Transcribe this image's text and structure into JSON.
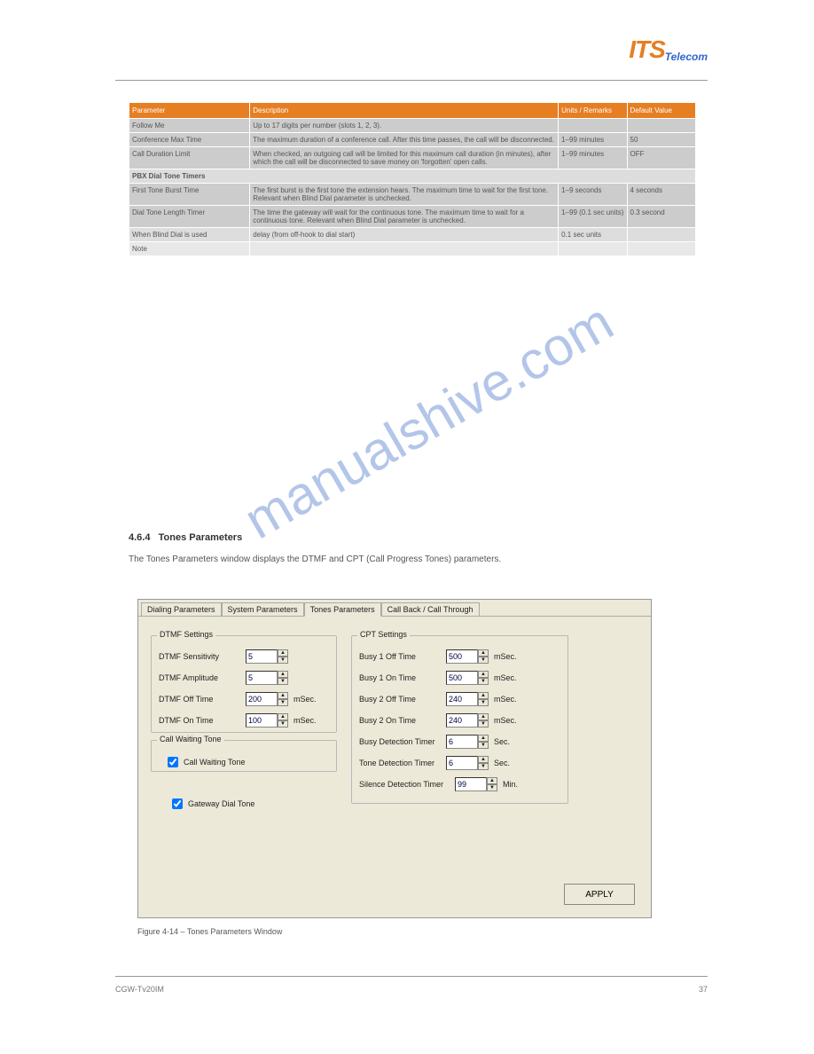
{
  "logo": {
    "its": "ITS",
    "telecom": "Telecom"
  },
  "table": {
    "headers": [
      "Parameter",
      "Description",
      "Units / Remarks",
      "Default Value"
    ],
    "rows": [
      {
        "c1": "Follow Me",
        "c2": "Up to 17 digits per number (slots 1, 2, 3).",
        "c3": "",
        "c4": ""
      },
      {
        "c1": "Conference Max Time",
        "c2": "The maximum duration of a conference call. After this time passes, the call will be disconnected.",
        "c3": "1–99 minutes",
        "c4": "50"
      },
      {
        "c1": "Call Duration Limit",
        "c2": "When checked, an outgoing call will be limited for this maximum call duration (in minutes), after which the call will be disconnected to save money on 'forgotten' open calls.",
        "c3": "1–99 minutes",
        "c4": "OFF"
      }
    ],
    "section": "PBX Dial Tone Timers",
    "rows2": [
      {
        "c1": "First Tone Burst Time",
        "c2": "The first burst is the first tone the extension hears. The maximum time to wait for the first tone. Relevant when Blind Dial parameter is unchecked.",
        "c3": "1–9 seconds",
        "c4": "4 seconds"
      },
      {
        "c1": "Dial Tone Length Timer",
        "c2": "The time the gateway will wait for the continuous tone. The maximum time to wait for a continuous tone. Relevant when Blind Dial parameter is unchecked.",
        "c3": "1–99 (0.1 sec units)",
        "c4": "0.3 second"
      },
      {
        "c1": "When Blind Dial is used",
        "c2": "delay (from off-hook to dial start)",
        "c3": "0.1 sec units",
        "c4": ""
      },
      {
        "c1": "Note",
        "c2": "",
        "c3": "",
        "c4": ""
      }
    ]
  },
  "section": {
    "num": "4.6.4",
    "title": "Tones Parameters",
    "desc": "The Tones Parameters window displays the DTMF and CPT (Call Progress Tones) parameters."
  },
  "panel": {
    "tabs": [
      "Dialing Parameters",
      "System Parameters",
      "Tones Parameters",
      "Call Back / Call Through"
    ],
    "dtmf": {
      "title": "DTMF Settings",
      "rows": [
        {
          "label": "DTMF Sensitivity",
          "value": "5",
          "unit": ""
        },
        {
          "label": "DTMF Amplitude",
          "value": "5",
          "unit": ""
        },
        {
          "label": "DTMF Off Time",
          "value": "200",
          "unit": "mSec."
        },
        {
          "label": "DTMF On Time",
          "value": "100",
          "unit": "mSec."
        }
      ]
    },
    "cwt": {
      "title": "Call Waiting Tone",
      "check": "Call Waiting Tone"
    },
    "gdt": {
      "check": "Gateway Dial Tone"
    },
    "cpt": {
      "title": "CPT Settings",
      "rows": [
        {
          "label": "Busy 1 Off Time",
          "value": "500",
          "unit": "mSec."
        },
        {
          "label": "Busy 1 On Time",
          "value": "500",
          "unit": "mSec."
        },
        {
          "label": "Busy 2 Off Time",
          "value": "240",
          "unit": "mSec."
        },
        {
          "label": "Busy 2 On Time",
          "value": "240",
          "unit": "mSec."
        },
        {
          "label": "Busy Detection Timer",
          "value": "6",
          "unit": "Sec."
        },
        {
          "label": "Tone Detection Timer",
          "value": "6",
          "unit": "Sec."
        },
        {
          "label": "Silence Detection Timer",
          "value": "99",
          "unit": "Min."
        }
      ]
    },
    "apply": "APPLY"
  },
  "figcaption": "Figure 4-14 – Tones Parameters Window",
  "footer": {
    "left": "CGW-Tv20IM",
    "right": "37"
  },
  "watermark": "manualshive.com"
}
